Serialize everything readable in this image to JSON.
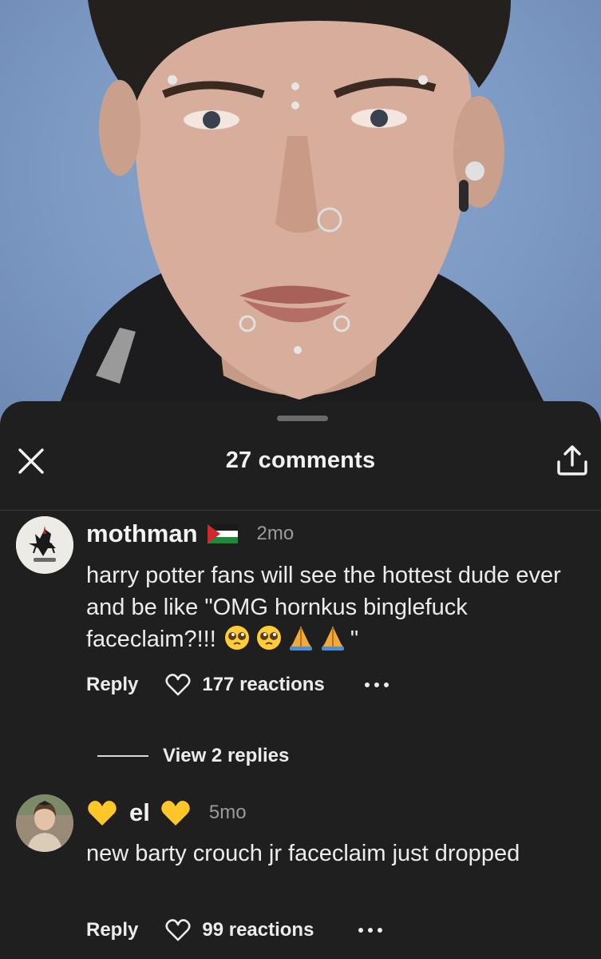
{
  "sheet": {
    "title": "27 comments"
  },
  "icons": {
    "close": "close-icon",
    "share": "share-icon",
    "heart": "heart-icon",
    "more": "more-dots-icon"
  },
  "colors": {
    "sheet_background": "#1f1f1f",
    "photo_background": "#7d9ac4"
  },
  "comments": [
    {
      "username": "mothman",
      "flag": "palestine-flag",
      "time": "2mo",
      "text": "harry potter fans will see the hottest dude ever and be like \"OMG hornkus binglefuck faceclaim?!!!",
      "text_emojis": [
        "pleading-face",
        "pleading-face",
        "folded-hands",
        "folded-hands"
      ],
      "text_end": "\"",
      "reply_label": "Reply",
      "reactions": "177 reactions",
      "view_replies": "View 2 replies"
    },
    {
      "username_prefix_emoji": "yellow-heart",
      "username": "el",
      "username_suffix_emoji": "yellow-heart",
      "time": "5mo",
      "text": "new barty crouch jr faceclaim just dropped",
      "reply_label": "Reply",
      "reactions": "99 reactions"
    }
  ]
}
